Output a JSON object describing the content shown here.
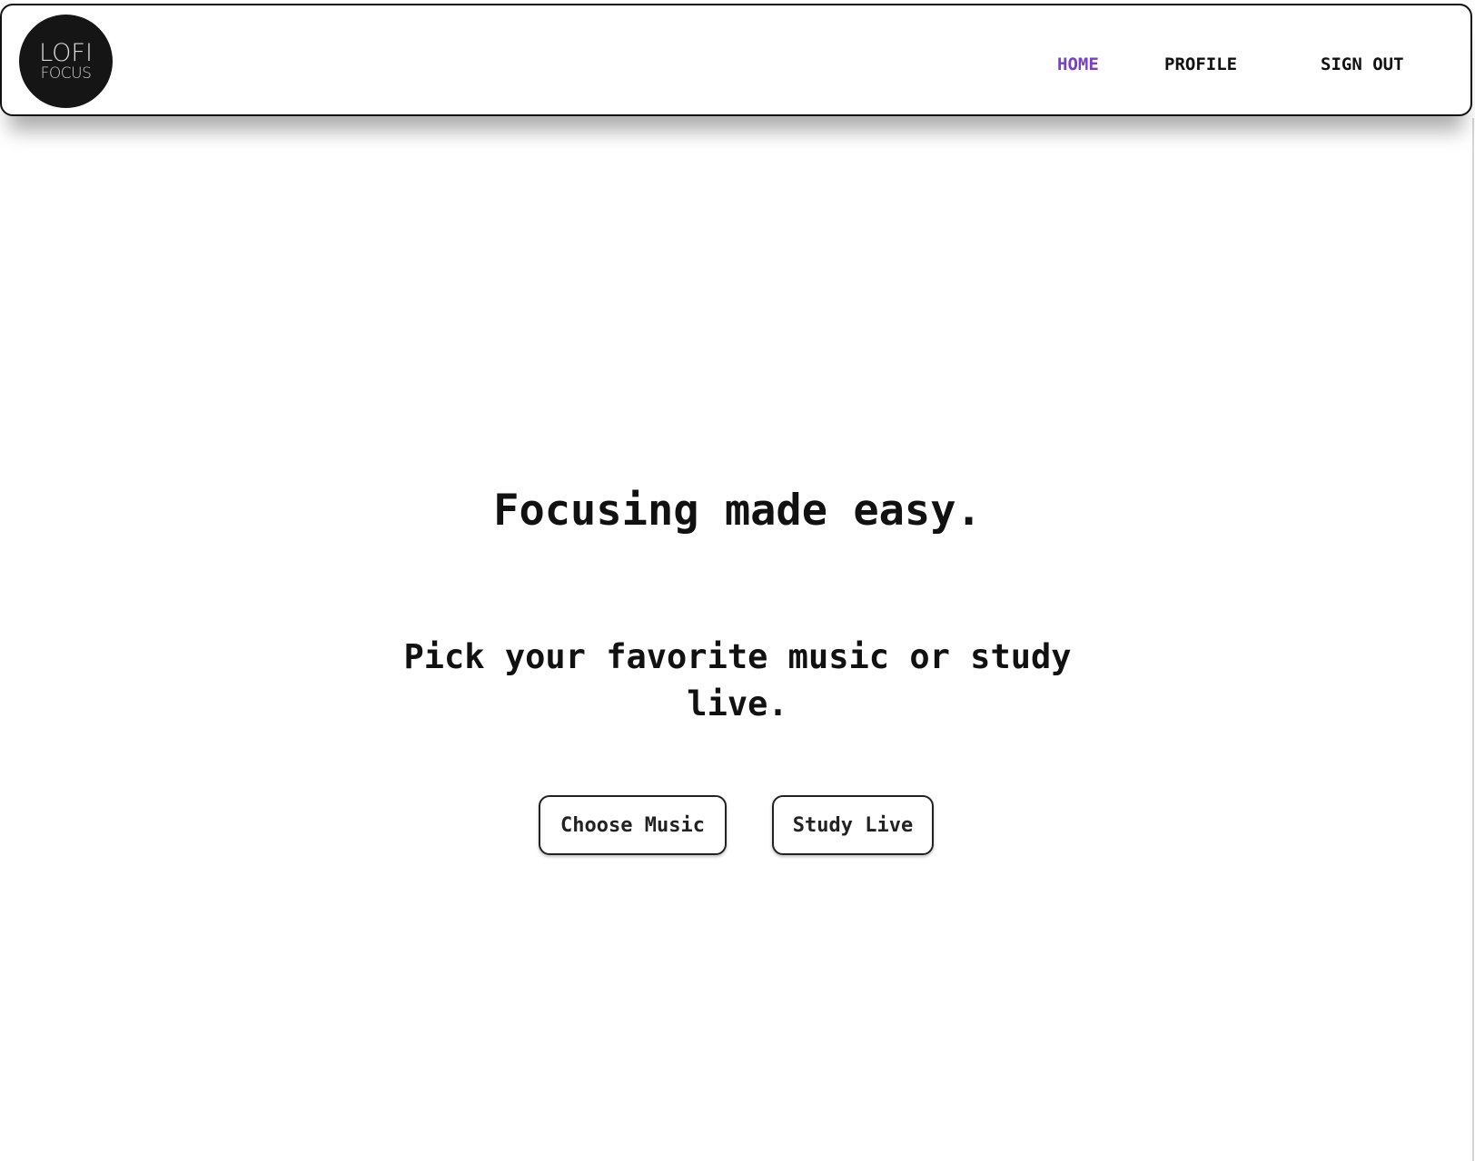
{
  "logo": {
    "line1": "LOFI",
    "line2": "FOCUS"
  },
  "nav": {
    "items": [
      {
        "label": "HOME",
        "active": true
      },
      {
        "label": "PROFILE",
        "active": false
      },
      {
        "label": "SIGN OUT",
        "active": false
      }
    ]
  },
  "hero": {
    "title": "Focusing made easy.",
    "subtitle": "Pick your favorite music or study live."
  },
  "actions": {
    "choose_music": "Choose Music",
    "study_live": "Study Live"
  },
  "colors": {
    "accent": "#7a3fc9",
    "text": "#111111",
    "logo_bg": "#151515",
    "background": "#ffffff"
  }
}
